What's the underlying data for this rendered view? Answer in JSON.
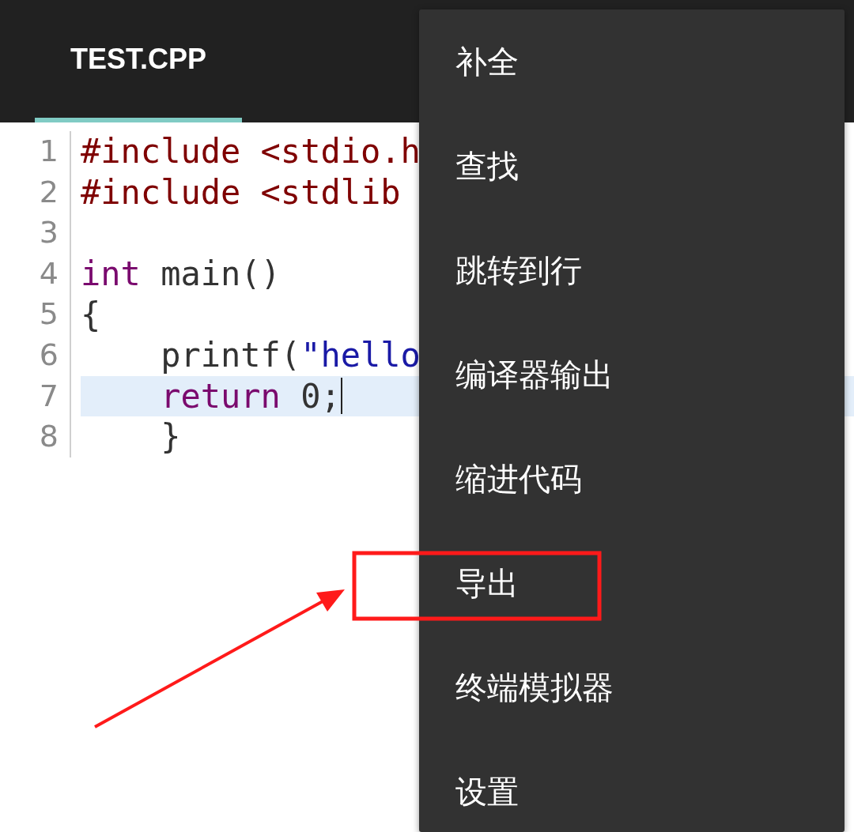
{
  "tabs": [
    {
      "label": "TEST.CPP",
      "selected": true
    }
  ],
  "code_lines": [
    {
      "number": "1",
      "current": false,
      "tokens": [
        {
          "text": "#include <stdio.h",
          "kind": "preproc"
        }
      ]
    },
    {
      "number": "2",
      "current": false,
      "tokens": [
        {
          "text": "#include <stdlib",
          "kind": "preproc"
        }
      ]
    },
    {
      "number": "3",
      "current": false
    },
    {
      "number": "4",
      "current": false,
      "tokens": [
        {
          "text": "int",
          "kind": "keyword"
        },
        {
          "text": " main()",
          "kind": "plain"
        }
      ]
    },
    {
      "number": "5",
      "current": false,
      "tokens": [
        {
          "text": "{",
          "kind": "plain"
        }
      ]
    },
    {
      "number": "6",
      "current": false,
      "tokens": [
        {
          "text": "    printf(",
          "kind": "plain"
        },
        {
          "text": "\"hello",
          "kind": "string"
        }
      ]
    },
    {
      "number": "7",
      "current": true,
      "tokens": [
        {
          "text": "    return",
          "kind": "keyword"
        },
        {
          "text": " 0;",
          "kind": "plain"
        }
      ]
    },
    {
      "number": "8",
      "current": false,
      "tokens": [
        {
          "text": "    }",
          "kind": "plain"
        }
      ]
    }
  ],
  "menu": {
    "items": [
      {
        "label": "补全"
      },
      {
        "label": "查找"
      },
      {
        "label": "跳转到行"
      },
      {
        "label": "编译器输出"
      },
      {
        "label": "缩进代码"
      },
      {
        "label": "导出"
      },
      {
        "label": "终端模拟器"
      },
      {
        "label": "设置"
      }
    ]
  }
}
